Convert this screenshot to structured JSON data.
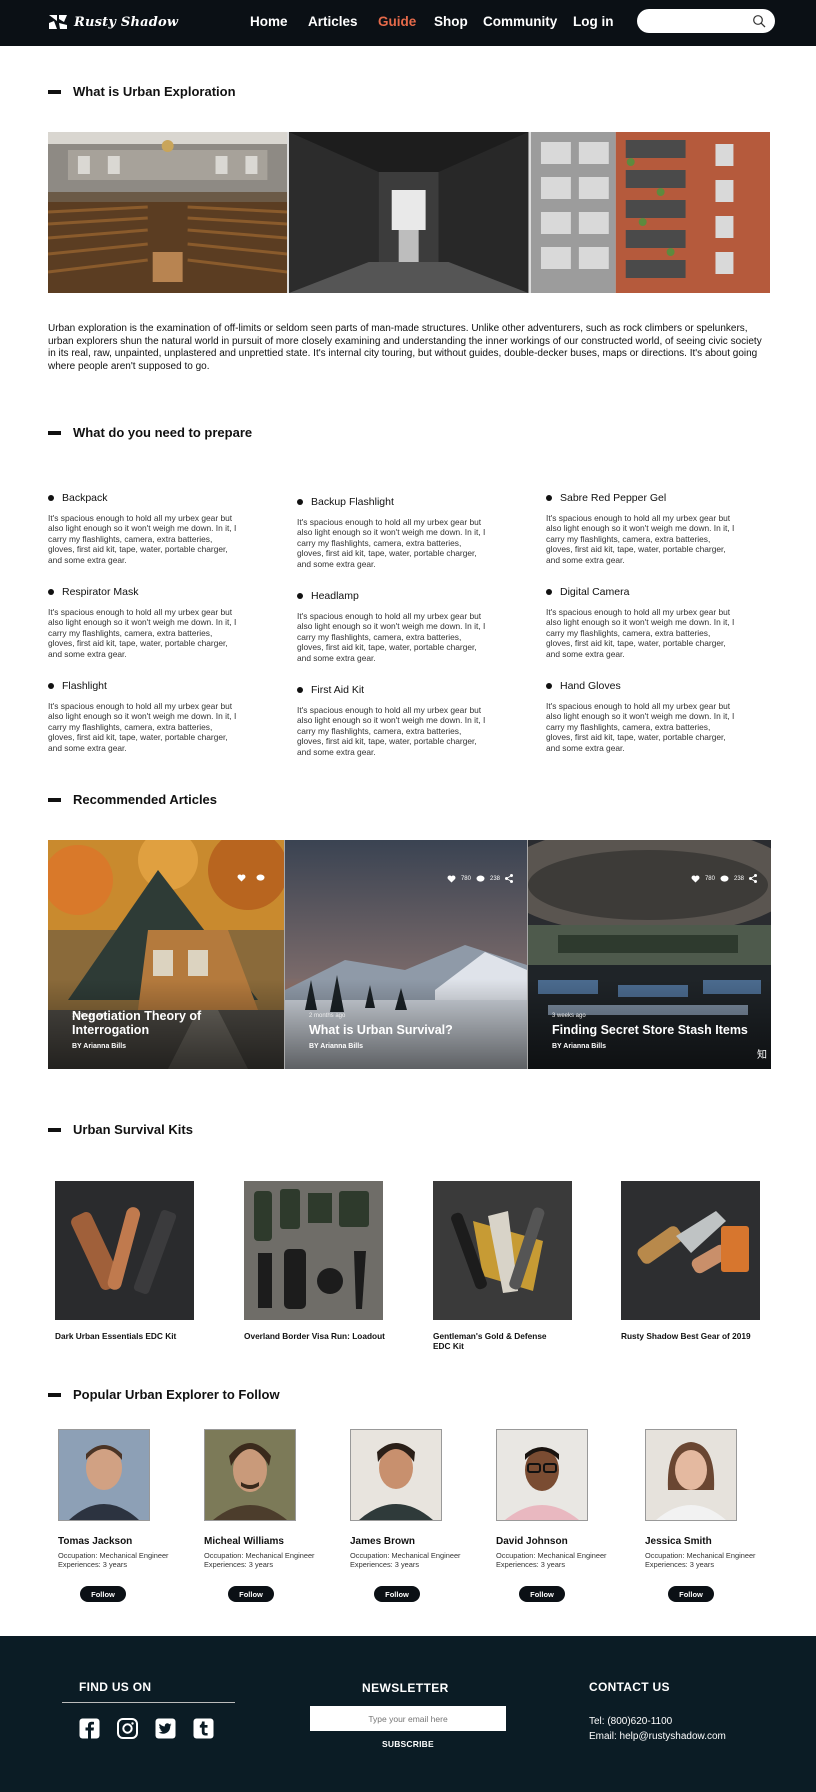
{
  "header": {
    "logo_text": "Rusty Shadow",
    "nav": [
      {
        "label": "Home",
        "active": false
      },
      {
        "label": "Articles",
        "active": false
      },
      {
        "label": "Guide",
        "active": true
      },
      {
        "label": "Shop",
        "active": false
      },
      {
        "label": "Community",
        "active": false
      },
      {
        "label": "Log in",
        "active": false
      }
    ],
    "search_placeholder": "",
    "active_color": "#e66a4a"
  },
  "intro": {
    "title": "What is Urban Exploration",
    "text": "Urban exploration is the examination of off-limits or seldom seen parts of man-made structures. Unlike other adventurers, such as rock climbers or spelunkers, urban explorers shun the natural world in pursuit of more closely examining and understanding the inner workings of our constructed world, of seeing civic society in its real, raw, unpainted, unplastered and unprettied state. It's internal city touring, but without guides, double-decker buses, maps or directions. It's about going where people aren't supposed to go."
  },
  "prepare": {
    "title": "What do you need to prepare",
    "items": [
      {
        "title": "Backpack",
        "desc": "It's spacious enough to hold all my urbex gear but also light enough so it won't weigh me down. In it, I carry my flashlights, camera, extra batteries, gloves, first aid kit, tape, water, portable charger, and some extra gear."
      },
      {
        "title": "Backup Flashlight",
        "desc": "It's spacious enough to hold all my urbex gear but also light enough so it won't weigh me down. In it, I carry my flashlights, camera, extra batteries, gloves, first aid kit, tape, water, portable charger, and some extra gear."
      },
      {
        "title": "Sabre Red Pepper Gel",
        "desc": "It's spacious enough to hold all my urbex gear but also light enough so it won't weigh me down. In it, I carry my flashlights, camera, extra batteries, gloves, first aid kit, tape, water, portable charger, and some extra gear."
      },
      {
        "title": "Respirator Mask",
        "desc": "It's spacious enough to hold all my urbex gear but also light enough so it won't weigh me down. In it, I carry my flashlights, camera, extra batteries, gloves, first aid kit, tape, water, portable charger, and some extra gear."
      },
      {
        "title": "Headlamp",
        "desc": "It's spacious enough to hold all my urbex gear but also light enough so it won't weigh me down. In it, I carry my flashlights, camera, extra batteries, gloves, first aid kit, tape, water, portable charger, and some extra gear."
      },
      {
        "title": "Digital Camera",
        "desc": "It's spacious enough to hold all my urbex gear but also light enough so it won't weigh me down. In it, I carry my flashlights, camera, extra batteries, gloves, first aid kit, tape, water, portable charger, and some extra gear."
      },
      {
        "title": "Flashlight",
        "desc": "It's spacious enough to hold all my urbex gear but also light enough so it won't weigh me down. In it, I carry my flashlights, camera, extra batteries, gloves, first aid kit, tape, water, portable charger, and some extra gear."
      },
      {
        "title": "First Aid Kit",
        "desc": "It's spacious enough to hold all my urbex gear but also light enough so it won't weigh me down. In it, I carry my flashlights, camera, extra batteries, gloves, first aid kit, tape, water, portable charger, and some extra gear."
      },
      {
        "title": "Hand Gloves",
        "desc": "It's spacious enough to hold all my urbex gear but also light enough so it won't weigh me down. In it, I carry my flashlights, camera, extra batteries, gloves, first aid kit, tape, water, portable charger, and some extra gear."
      }
    ]
  },
  "articles": {
    "title": "Recommended Articles",
    "items": [
      {
        "time": "1 minute ago",
        "title_line1": "Negotiation Theory of",
        "title_line2": "Interrogation",
        "author": "BY Arianna Bills",
        "likes": "",
        "comments": ""
      },
      {
        "time": "2 months ago",
        "title_line1": "What is Urban Survival?",
        "title_line2": "",
        "author": "BY Arianna Bills",
        "likes": "780",
        "comments": "238"
      },
      {
        "time": "3 weeks ago",
        "title_line1": "Finding Secret Store Stash Items",
        "title_line2": "",
        "author": "BY Arianna Bills",
        "likes": "780",
        "comments": "238"
      }
    ],
    "corner_glyph": "知"
  },
  "kits": {
    "title": "Urban Survival Kits",
    "items": [
      {
        "name_line1": "Dark Urban Essentials EDC Kit",
        "name_line2": ""
      },
      {
        "name_line1": "Overland Border Visa Run: Loadout",
        "name_line2": ""
      },
      {
        "name_line1": "Gentleman's Gold & Defense",
        "name_line2": "EDC Kit"
      },
      {
        "name_line1": "Rusty Shadow Best Gear of 2019",
        "name_line2": ""
      }
    ]
  },
  "explorers": {
    "title": "Popular Urban Explorer to Follow",
    "follow_label": "Follow",
    "items": [
      {
        "name": "Tomas Jackson",
        "occupation": "Occupation: Mechanical Engineer",
        "experience": "Experiences: 3 years"
      },
      {
        "name": "Micheal Williams",
        "occupation": "Occupation: Mechanical Engineer",
        "experience": "Experiences: 3 years"
      },
      {
        "name": "James Brown",
        "occupation": "Occupation: Mechanical Engineer",
        "experience": "Experiences: 3 years"
      },
      {
        "name": "David Johnson",
        "occupation": "Occupation: Mechanical Engineer",
        "experience": "Experiences: 3 years"
      },
      {
        "name": "Jessica Smith",
        "occupation": "Occupation: Mechanical Engineer",
        "experience": "Experiences: 3 years"
      }
    ]
  },
  "footer": {
    "find_us": "FIND US ON",
    "socials": [
      "facebook-icon",
      "instagram-icon",
      "twitter-icon",
      "tumblr-icon"
    ],
    "newsletter_title": "NEWSLETTER",
    "email_placeholder": "Type your email here",
    "subscribe_label": "SUBSCRIBE",
    "contact_title": "CONTACT US",
    "tel": "Tel: (800)620-1100",
    "email": "Email: help@rustyshadow.com"
  }
}
